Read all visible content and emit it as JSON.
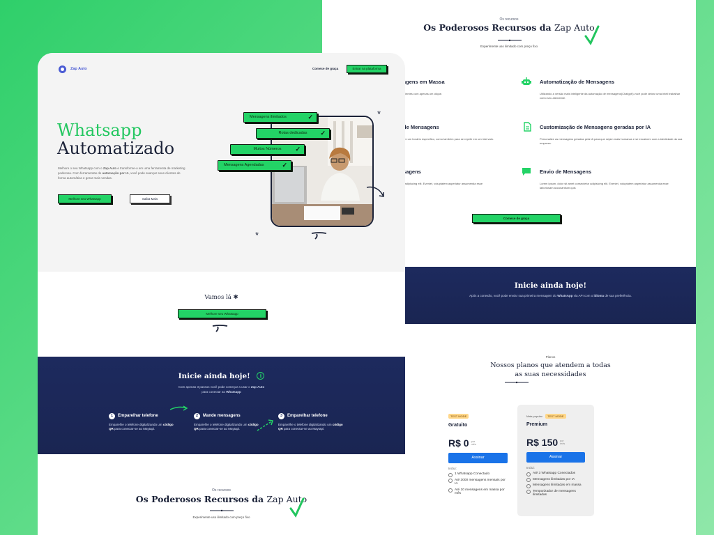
{
  "right_top": {
    "eyebrow": "Os recursos",
    "title_bold": "Os Poderosos Recursos da",
    "title_light": "Zap Auto",
    "subtitle": "Experimente uso ilimitado com preço fixo"
  },
  "features": [
    {
      "title": "agens em Massa",
      "desc": "olientes com apenas um clique."
    },
    {
      "title": "Automatização de Mensagens",
      "desc": "Utilizando a versão mais inteligente da automação de mensagens(ChatgptI) você pode deixar uma inteli trabalhar como seu atendente."
    },
    {
      "title": "de Mensagens",
      "desc": "em um horário específico, como também para se repetir em um intervalo."
    },
    {
      "title": "Customização de Mensagens geradas por IA",
      "desc": "Personalize as mensagens geradas pela IA para que sejam mais humanas e se encaixem com a identidade da sua empresa."
    },
    {
      "title": "sagens",
      "desc": "r adipiscing elit. Eveniet, voluptatem asperiatur assumenda esse"
    },
    {
      "title": "Envio de Mensagens",
      "desc": "Lorem ipsum, dolor sit amet consectetur adipisicing elit. Eveniet, voluptatem asperiatur assumenda esse laboriosam accusantium quis"
    }
  ],
  "features_cta": "Comece de graça",
  "blue_band_right": {
    "title": "Inicie ainda hoje!",
    "text_pre": "Após a conexão, você pode enviar sua primeira mensagem do",
    "text_b1": "WhatsApp",
    "text_mid": "via API com o",
    "text_b2": "idioma",
    "text_post": "de sua preferência."
  },
  "plans_header": {
    "eyebrow": "Planos",
    "title_line1": "Nossos planos que atendem a todas",
    "title_line2": "as suas necessidades"
  },
  "plans": [
    {
      "tag": "TEST MODE",
      "name": "Gratuito",
      "price": "R$ 0",
      "per": "por mês",
      "button": "Assinar",
      "includes": "Inclui:",
      "items": [
        "1 Whatsapp Conectado",
        "Até 3000 mensagens mensais por IA",
        "Até 10 mensagens em massa por mês"
      ]
    },
    {
      "popular": "Mais popular",
      "tag": "TEST MODE",
      "name": "Premium",
      "price": "R$ 150",
      "per": "por mês",
      "button": "Assinar",
      "includes": "Inclui:",
      "items": [
        "Até 3 Whatsapp Conectados",
        "Mensagens ilimitadas por IA",
        "Mensagens ilimitadas em massa",
        "Temporizador de mensagens ilimitadas"
      ]
    }
  ],
  "nav": {
    "logo": "Zap Auto",
    "link": "Comece de graça",
    "button": "Entrar na plataforma"
  },
  "hero": {
    "title_green": "Whatsapp",
    "title_dark": "Automatizado",
    "desc_pre": "Melhore o seu Whatsapp com o",
    "desc_b1": "Zap Auto",
    "desc_mid": "e transforme-o em uma ferramenta de marketing poderosa. Com ferramentas de",
    "desc_b2": "automação por IA",
    "desc_post": ", você pode avançar seus clientes de forma automática e gerar mais vendas.",
    "btn_primary": "Melhore seu Whatsapp",
    "btn_secondary": "Saiba Mais",
    "tags": [
      "Mensagens ilimitados",
      "Rotas dedicadas",
      "Muitos Números",
      "Mensagens Agendadas"
    ]
  },
  "vamos": {
    "title": "Vamos lá",
    "button": "Melhore seu Whatsapp"
  },
  "blue_band_left": {
    "title": "Inicie ainda hoje!",
    "text_pre": "Com apenas 3 passos você pode começar a usar o",
    "text_b1": "Zap Auto",
    "text_mid": "para conectar ao",
    "text_b2": "Whatsapp",
    "steps": [
      {
        "num": "1",
        "title": "Emparelhar telefone",
        "pre": "Emparelhe o telefone digitalizando um",
        "b": "código QR",
        "post": "para conectar-se ao Maytapi."
      },
      {
        "num": "2",
        "title": "Mande mensagens",
        "pre": "Emparelhe o telefone digitalizando um",
        "b": "código QR",
        "post": "para conectar-se ao Maytapi."
      },
      {
        "num": "3",
        "title": "Emparelhar telefone",
        "pre": "Emparelhe o telefone digitalizando um",
        "b": "código QR",
        "post": "para conectar-se ao Maytapi."
      }
    ]
  },
  "bottom_left": {
    "eyebrow": "Os recursos",
    "title_bold": "Os Poderosos Recursos da",
    "title_light": "Zap Auto",
    "subtitle": "Experimente uso ilimitado com preço fixo"
  },
  "colors": {
    "green": "#23d366",
    "navy": "#1d2a5e",
    "blue": "#1a73e8"
  }
}
